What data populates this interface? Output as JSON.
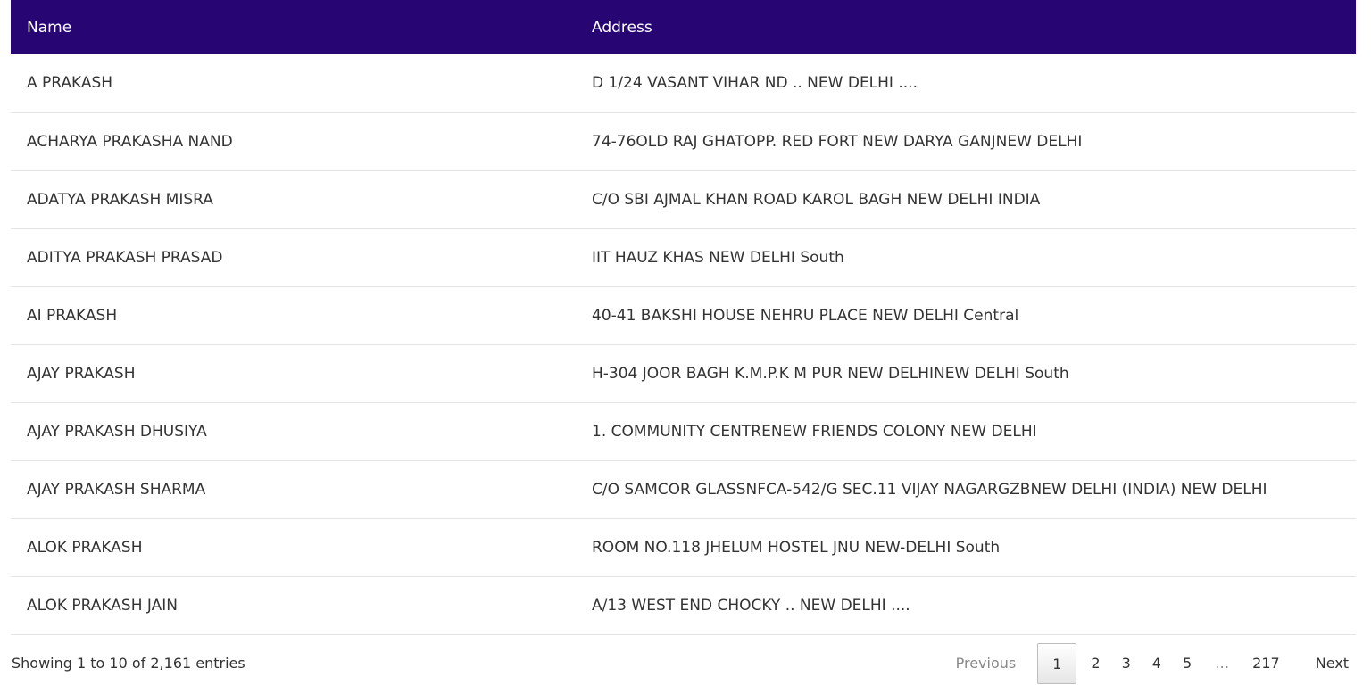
{
  "table": {
    "columns": [
      "Name",
      "Address"
    ],
    "rows": [
      {
        "name": "A PRAKASH",
        "address": "D 1/24 VASANT VIHAR ND .. NEW DELHI ...."
      },
      {
        "name": "ACHARYA PRAKASHA NAND",
        "address": "74-76OLD RAJ GHATOPP. RED FORT NEW DARYA GANJNEW DELHI"
      },
      {
        "name": "ADATYA PRAKASH MISRA",
        "address": "C/O SBI AJMAL KHAN ROAD KAROL BAGH NEW DELHI INDIA"
      },
      {
        "name": "ADITYA PRAKASH PRASAD",
        "address": "IIT HAUZ KHAS NEW DELHI South"
      },
      {
        "name": "AI PRAKASH",
        "address": "40-41 BAKSHI HOUSE NEHRU PLACE NEW DELHI Central"
      },
      {
        "name": "AJAY PRAKASH",
        "address": "H-304 JOOR BAGH K.M.P.K M PUR NEW DELHINEW DELHI South"
      },
      {
        "name": "AJAY PRAKASH DHUSIYA",
        "address": "1. COMMUNITY CENTRENEW FRIENDS COLONY NEW DELHI"
      },
      {
        "name": "AJAY PRAKASH SHARMA",
        "address": "C/O SAMCOR GLASSNFCA-542/G SEC.11 VIJAY NAGARGZBNEW DELHI (INDIA) NEW DELHI"
      },
      {
        "name": "ALOK PRAKASH",
        "address": "ROOM NO.118 JHELUM HOSTEL JNU NEW-DELHI South"
      },
      {
        "name": "ALOK PRAKASH JAIN",
        "address": "A/13 WEST END CHOCKY .. NEW DELHI ...."
      }
    ]
  },
  "footer": {
    "info": "Showing 1 to 10 of 2,161 entries",
    "previous_label": "Previous",
    "next_label": "Next",
    "pages": [
      "1",
      "2",
      "3",
      "4",
      "5"
    ],
    "ellipsis": "…",
    "last_page": "217",
    "current_page": "1"
  },
  "colors": {
    "header_bg": "#270673",
    "header_text": "#ffffff",
    "row_border": "#e4e4e4"
  }
}
